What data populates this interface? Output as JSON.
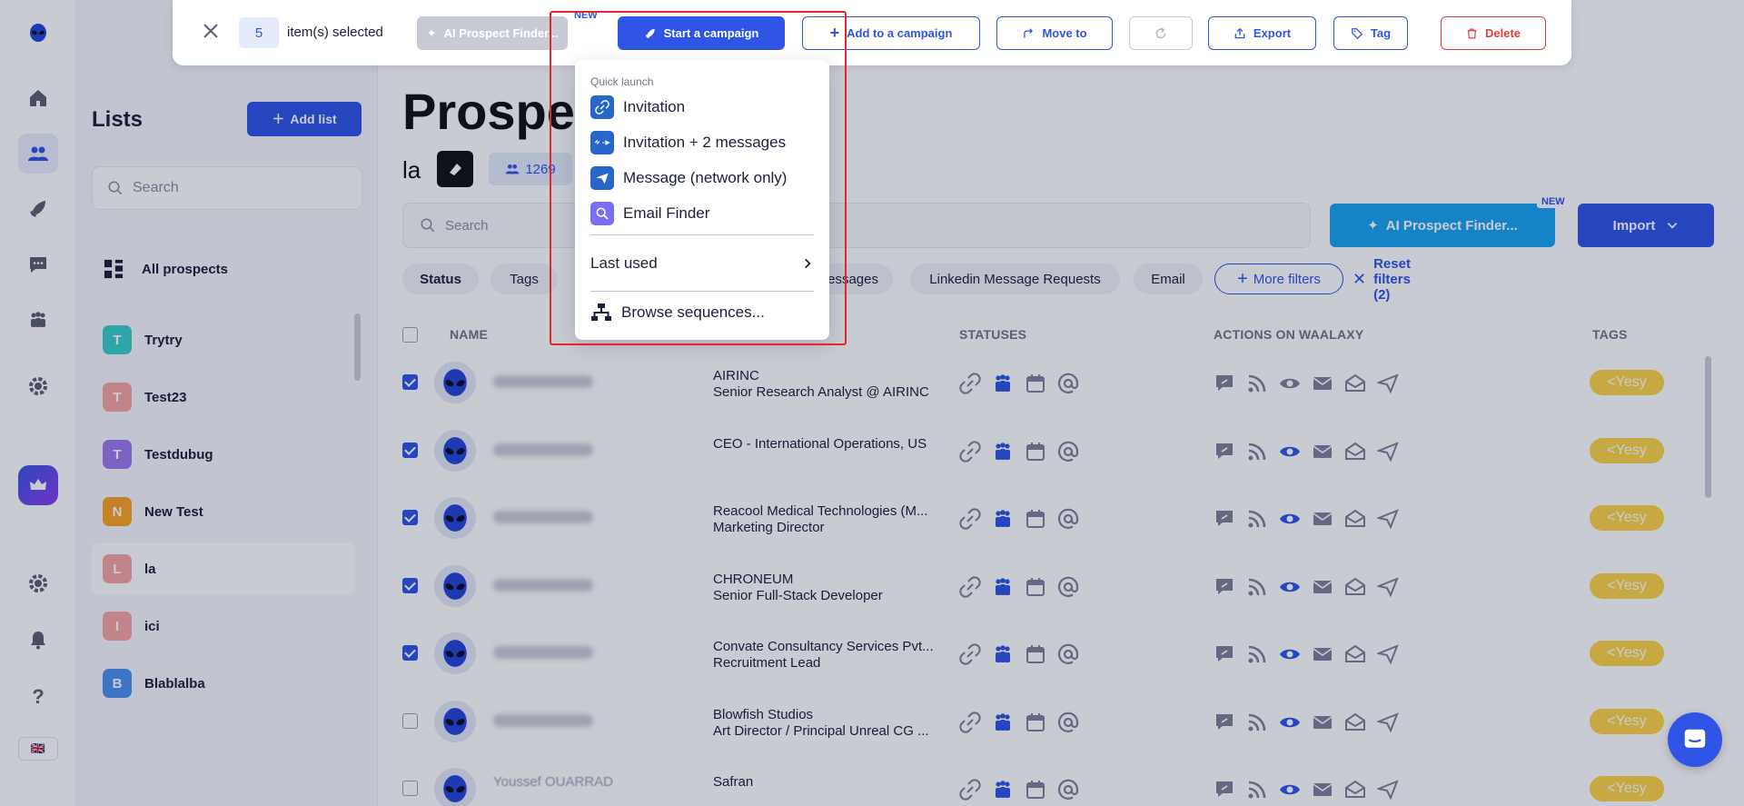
{
  "rail": {
    "language_flag": "🇬🇧"
  },
  "lists": {
    "title": "Lists",
    "add_button": "Add list",
    "search_placeholder": "Search",
    "all_prospects": "All prospects",
    "items": [
      {
        "letter": "T",
        "name": "Trytry",
        "color": "#3ccfc8"
      },
      {
        "letter": "T",
        "name": "Test23",
        "color": "#f6a5a5"
      },
      {
        "letter": "T",
        "name": "Testdubug",
        "color": "#9b79ec"
      },
      {
        "letter": "N",
        "name": "New Test",
        "color": "#fba322"
      },
      {
        "letter": "L",
        "name": "la",
        "color": "#f6a5a5"
      },
      {
        "letter": "I",
        "name": "ici",
        "color": "#f6a5a5"
      },
      {
        "letter": "B",
        "name": "Blablalba",
        "color": "#4c90f0"
      }
    ]
  },
  "main": {
    "title": "Prospects",
    "list_name": "la",
    "prospect_count": "1269",
    "search_placeholder": "Search",
    "ai_finder": "AI Prospect Finder...",
    "new_badge": "NEW",
    "import": "Import",
    "filters": [
      "Status",
      "Tags",
      "Messages",
      "Linkedin Message Requests",
      "Email"
    ],
    "more_filters": "More filters",
    "reset_filters": "Reset filters (2)",
    "columns": {
      "name": "NAME",
      "statuses": "STATUSES",
      "actions": "ACTIONS ON WAALAXY",
      "tags": "TAGS"
    },
    "rows": [
      {
        "checked": true,
        "company": "AIRINC",
        "title": "Senior Research Analyst @ AIRINC",
        "tag": "<Yesy"
      },
      {
        "checked": true,
        "company": "CEO - International Operations, US",
        "title": "",
        "tag": "<Yesy"
      },
      {
        "checked": true,
        "company": "Reacool Medical Technologies  (M...",
        "title": "Marketing Director",
        "tag": "<Yesy"
      },
      {
        "checked": true,
        "company": "CHRONEUM",
        "title": "Senior Full-Stack Developer",
        "tag": "<Yesy"
      },
      {
        "checked": true,
        "company": "Convate Consultancy Services Pvt...",
        "title": "Recruitment Lead",
        "tag": "<Yesy"
      },
      {
        "checked": false,
        "company": "Blowfish Studios",
        "title": "Art Director / Principal Unreal CG ...",
        "tag": "<Yesy"
      },
      {
        "checked": false,
        "company": "Safran",
        "title": "",
        "tag": "<Yesy"
      }
    ],
    "last_row_name": "Youssef OUARRAD"
  },
  "selection_bar": {
    "count": "5",
    "text": "item(s) selected",
    "ai_finder": "AI Prospect Finder...",
    "new_badge": "NEW",
    "start_campaign": "Start a campaign",
    "add_to_campaign": "Add to a campaign",
    "move_to": "Move to",
    "export": "Export",
    "tag": "Tag",
    "delete": "Delete"
  },
  "dropdown": {
    "section_label": "Quick launch",
    "items": [
      "Invitation",
      "Invitation + 2 messages",
      "Message (network only)",
      "Email Finder"
    ],
    "last_used": "Last used",
    "browse": "Browse sequences..."
  },
  "colors": {
    "primary": "#2f54e6",
    "ai_blue": "#1aa3f0",
    "tag_yellow": "#fbd448",
    "danger": "#e23d3d"
  }
}
